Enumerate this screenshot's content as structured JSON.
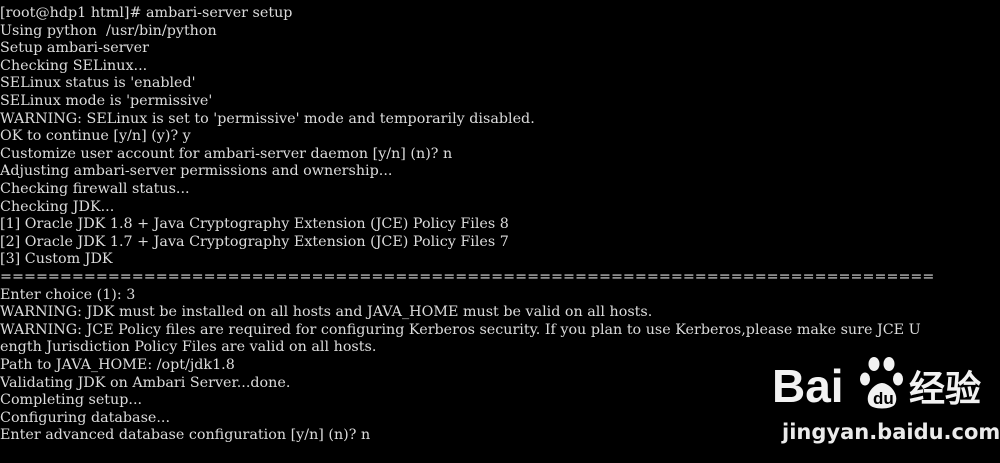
{
  "terminal": {
    "lines": [
      "[root@hdp1 html]# ambari-server setup",
      "Using python  /usr/bin/python",
      "Setup ambari-server",
      "Checking SELinux...",
      "SELinux status is 'enabled'",
      "SELinux mode is 'permissive'",
      "WARNING: SELinux is set to 'permissive' mode and temporarily disabled.",
      "OK to continue [y/n] (y)? y",
      "Customize user account for ambari-server daemon [y/n] (n)? n",
      "Adjusting ambari-server permissions and ownership...",
      "Checking firewall status...",
      "Checking JDK...",
      "[1] Oracle JDK 1.8 + Java Cryptography Extension (JCE) Policy Files 8",
      "[2] Oracle JDK 1.7 + Java Cryptography Extension (JCE) Policy Files 7",
      "[3] Custom JDK",
      "==============================================================================",
      "Enter choice (1): 3",
      "WARNING: JDK must be installed on all hosts and JAVA_HOME must be valid on all hosts.",
      "WARNING: JCE Policy files are required for configuring Kerberos security. If you plan to use Kerberos,please make sure JCE U",
      "ength Jurisdiction Policy Files are valid on all hosts.",
      "Path to JAVA_HOME: /opt/jdk1.8",
      "Validating JDK on Ambari Server...done.",
      "Completing setup...",
      "Configuring database...",
      "Enter advanced database configuration [y/n] (n)? n"
    ]
  },
  "watermark": {
    "brand_text": "Bai",
    "brand_suffix": "du",
    "brand_cn": "经验",
    "url": "jingyan.baidu.com",
    "icon": "paw-icon"
  },
  "colors": {
    "background": "#000000",
    "text": "#dcdcdc",
    "watermark": "#ffffff"
  }
}
